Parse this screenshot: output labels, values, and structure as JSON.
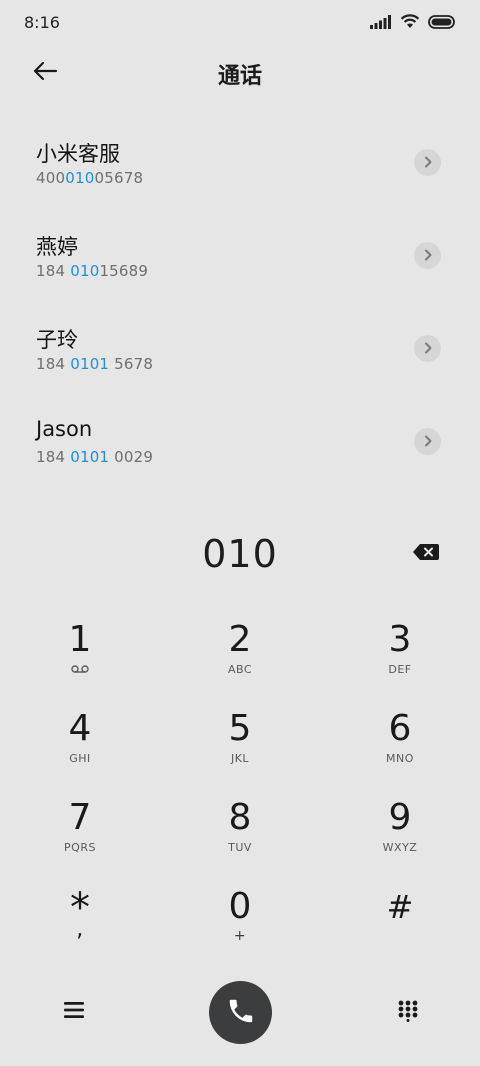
{
  "status_bar": {
    "time": "8:16",
    "icons": [
      "signal-icon",
      "wifi-icon",
      "battery-icon"
    ]
  },
  "header": {
    "back_icon": "arrow-left-icon",
    "title": "通话"
  },
  "contacts": [
    {
      "name": "小米客服",
      "number_pre": "400",
      "number_hl": "010",
      "number_post": "05678"
    },
    {
      "name": "燕婷",
      "number_pre": "184 ",
      "number_hl": "010",
      "number_post": "15689"
    },
    {
      "name": "子玲",
      "number_pre": "184 ",
      "number_hl": "0101",
      "number_post": " 5678"
    },
    {
      "name": "Jason",
      "number_pre": "184 ",
      "number_hl": "0101",
      "number_post": " 0029"
    }
  ],
  "dialer": {
    "input": "010",
    "backspace_icon": "backspace-icon"
  },
  "keypad": [
    {
      "digit": "1",
      "letters": "",
      "sub_icon": "voicemail-icon"
    },
    {
      "digit": "2",
      "letters": "ABC"
    },
    {
      "digit": "3",
      "letters": "DEF"
    },
    {
      "digit": "4",
      "letters": "GHI"
    },
    {
      "digit": "5",
      "letters": "JKL"
    },
    {
      "digit": "6",
      "letters": "MNO"
    },
    {
      "digit": "7",
      "letters": "PQRS"
    },
    {
      "digit": "8",
      "letters": "TUV"
    },
    {
      "digit": "9",
      "letters": "WXYZ"
    },
    {
      "digit": "*",
      "letters": ","
    },
    {
      "digit": "0",
      "letters": "+"
    },
    {
      "digit": "#",
      "letters": ""
    }
  ],
  "bottom_bar": {
    "menu_icon": "menu-icon",
    "call_icon": "phone-icon",
    "dialpad_icon": "dialpad-icon"
  },
  "colors": {
    "background": "#e6e6e6",
    "highlight": "#1f8fe0",
    "call_button": "#3b3d3f"
  }
}
